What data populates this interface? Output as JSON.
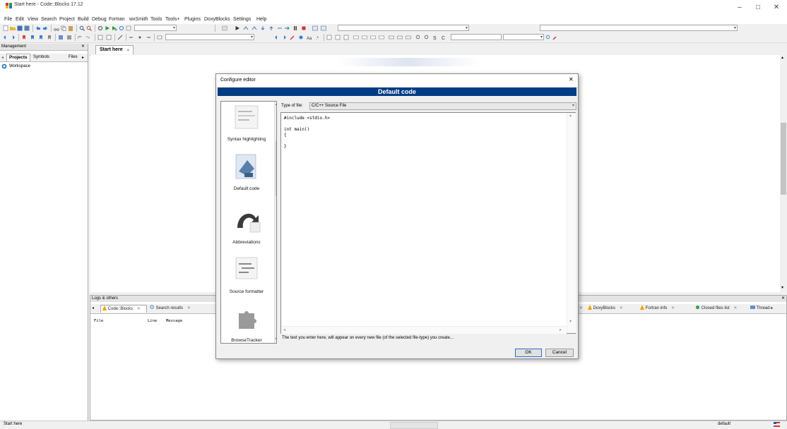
{
  "window": {
    "title": "Start here - Code::Blocks 17.12",
    "controls": {
      "minimize": "–",
      "maximize": "□",
      "close": "✕"
    }
  },
  "menu": [
    "File",
    "Edit",
    "View",
    "Search",
    "Project",
    "Build",
    "Debug",
    "Fortran",
    "wxSmith",
    "Tools",
    "Tools+",
    "Plugins",
    "DoxyBlocks",
    "Settings",
    "Help"
  ],
  "management": {
    "header": "Management",
    "close": "✕",
    "tabs": [
      "Projects",
      "Symbols",
      "Files"
    ],
    "tree_root": "Workspace"
  },
  "editor": {
    "tab_label": "Start here",
    "tab_close": "✕"
  },
  "logs": {
    "header": "Logs & others",
    "close": "✕",
    "tabs_left": [
      "Code::Blocks",
      "Search results"
    ],
    "tabs_right": [
      "DoxyBlocks",
      "Fortran info",
      "Closed files list",
      "Thread"
    ],
    "tab_close": "✕",
    "columns": [
      "File",
      "Line",
      "Message"
    ]
  },
  "status": {
    "left_text": "Start here",
    "right_text": "default"
  },
  "dialog": {
    "title": "Configure editor",
    "close": "✕",
    "header": "Default code",
    "categories": [
      "Syntax highlighting",
      "Default code",
      "Abbreviations",
      "Source formatter",
      "BrowseTracker"
    ],
    "type_label": "Type of file:",
    "type_value": "C/C++ Source File",
    "code": "#include <stdio.h>\n\nint main()\n{\n\n}",
    "hint": "The text you enter here, will appear on every new file (of the selected file-type) you create...",
    "ok_label": "OK",
    "cancel_label": "Cancel"
  },
  "colors": {
    "dialog_header": "#003c84",
    "tree_icon": "#1e73be"
  }
}
